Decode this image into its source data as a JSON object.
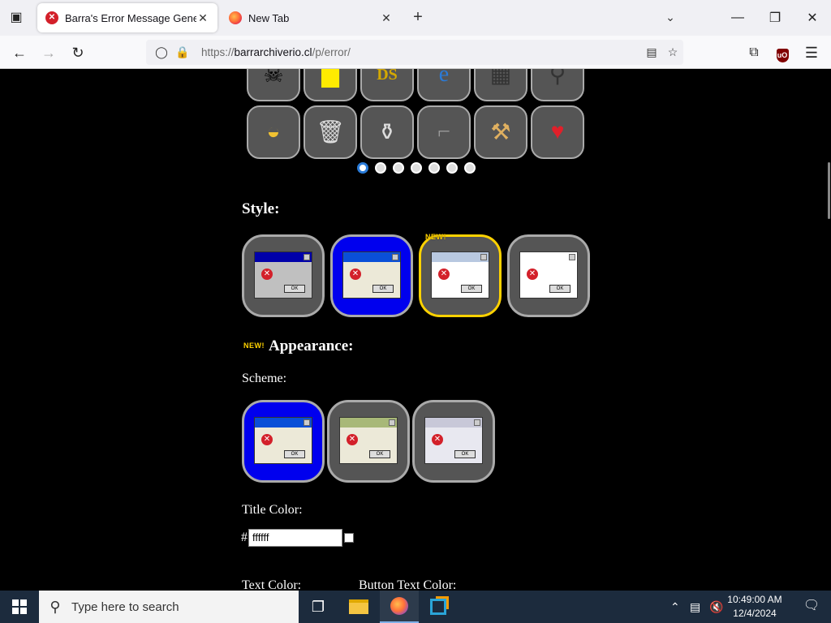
{
  "browser": {
    "tabs": [
      {
        "title": "Barra's Error Message Generator",
        "favicon": "error-icon",
        "active": true
      },
      {
        "title": "New Tab",
        "favicon": "firefox-icon",
        "active": false
      }
    ],
    "url_prefix": "https://",
    "url_host": "barrarchiverio.cl",
    "url_path": "/p/error/"
  },
  "page": {
    "icon_rows": [
      [
        "skull-icon",
        "sticky-note-icon",
        "dos-icon",
        "internet-explorer-icon",
        "windows-icon",
        "magnifier-icon"
      ],
      [
        "cheese-icon",
        "trash-can-icon",
        "vase-icon",
        "revolver-icon",
        "hammer-icon",
        "heart-icon"
      ]
    ],
    "carousel_dots": 7,
    "carousel_active": 0,
    "style_heading": "Style:",
    "styles": [
      "windows-98",
      "windows-xp",
      "windows-vista",
      "windows-7"
    ],
    "style_selected": 2,
    "new_badge": "NEW!",
    "appearance_heading": "Appearance:",
    "scheme_label": "Scheme:",
    "schemes": [
      "blue",
      "olive-green",
      "silver"
    ],
    "scheme_selected": 0,
    "title_color_label": "Title Color:",
    "hash": "#",
    "title_color_value": "ffffff",
    "text_color_label": "Text Color:",
    "button_text_color_label": "Button Text Color:"
  },
  "taskbar": {
    "search_placeholder": "Type here to search",
    "time": "10:49:00 AM",
    "date": "12/4/2024"
  }
}
